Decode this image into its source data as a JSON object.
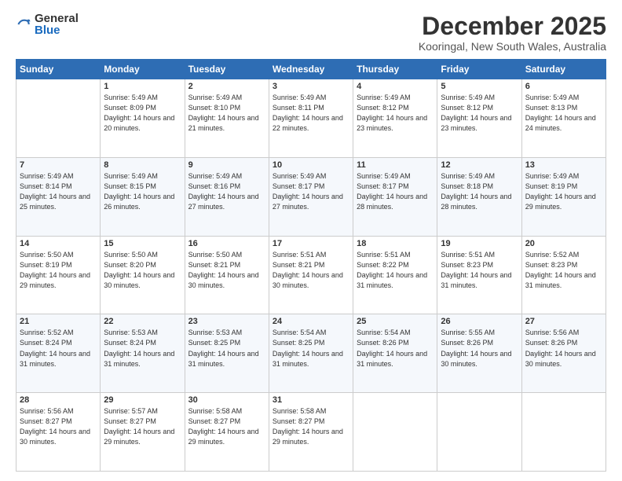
{
  "logo": {
    "general": "General",
    "blue": "Blue"
  },
  "title": "December 2025",
  "subtitle": "Kooringal, New South Wales, Australia",
  "days_header": [
    "Sunday",
    "Monday",
    "Tuesday",
    "Wednesday",
    "Thursday",
    "Friday",
    "Saturday"
  ],
  "weeks": [
    [
      {
        "day": "",
        "sunrise": "",
        "sunset": "",
        "daylight": ""
      },
      {
        "day": "1",
        "sunrise": "Sunrise: 5:49 AM",
        "sunset": "Sunset: 8:09 PM",
        "daylight": "Daylight: 14 hours and 20 minutes."
      },
      {
        "day": "2",
        "sunrise": "Sunrise: 5:49 AM",
        "sunset": "Sunset: 8:10 PM",
        "daylight": "Daylight: 14 hours and 21 minutes."
      },
      {
        "day": "3",
        "sunrise": "Sunrise: 5:49 AM",
        "sunset": "Sunset: 8:11 PM",
        "daylight": "Daylight: 14 hours and 22 minutes."
      },
      {
        "day": "4",
        "sunrise": "Sunrise: 5:49 AM",
        "sunset": "Sunset: 8:12 PM",
        "daylight": "Daylight: 14 hours and 23 minutes."
      },
      {
        "day": "5",
        "sunrise": "Sunrise: 5:49 AM",
        "sunset": "Sunset: 8:12 PM",
        "daylight": "Daylight: 14 hours and 23 minutes."
      },
      {
        "day": "6",
        "sunrise": "Sunrise: 5:49 AM",
        "sunset": "Sunset: 8:13 PM",
        "daylight": "Daylight: 14 hours and 24 minutes."
      }
    ],
    [
      {
        "day": "7",
        "sunrise": "Sunrise: 5:49 AM",
        "sunset": "Sunset: 8:14 PM",
        "daylight": "Daylight: 14 hours and 25 minutes."
      },
      {
        "day": "8",
        "sunrise": "Sunrise: 5:49 AM",
        "sunset": "Sunset: 8:15 PM",
        "daylight": "Daylight: 14 hours and 26 minutes."
      },
      {
        "day": "9",
        "sunrise": "Sunrise: 5:49 AM",
        "sunset": "Sunset: 8:16 PM",
        "daylight": "Daylight: 14 hours and 27 minutes."
      },
      {
        "day": "10",
        "sunrise": "Sunrise: 5:49 AM",
        "sunset": "Sunset: 8:17 PM",
        "daylight": "Daylight: 14 hours and 27 minutes."
      },
      {
        "day": "11",
        "sunrise": "Sunrise: 5:49 AM",
        "sunset": "Sunset: 8:17 PM",
        "daylight": "Daylight: 14 hours and 28 minutes."
      },
      {
        "day": "12",
        "sunrise": "Sunrise: 5:49 AM",
        "sunset": "Sunset: 8:18 PM",
        "daylight": "Daylight: 14 hours and 28 minutes."
      },
      {
        "day": "13",
        "sunrise": "Sunrise: 5:49 AM",
        "sunset": "Sunset: 8:19 PM",
        "daylight": "Daylight: 14 hours and 29 minutes."
      }
    ],
    [
      {
        "day": "14",
        "sunrise": "Sunrise: 5:50 AM",
        "sunset": "Sunset: 8:19 PM",
        "daylight": "Daylight: 14 hours and 29 minutes."
      },
      {
        "day": "15",
        "sunrise": "Sunrise: 5:50 AM",
        "sunset": "Sunset: 8:20 PM",
        "daylight": "Daylight: 14 hours and 30 minutes."
      },
      {
        "day": "16",
        "sunrise": "Sunrise: 5:50 AM",
        "sunset": "Sunset: 8:21 PM",
        "daylight": "Daylight: 14 hours and 30 minutes."
      },
      {
        "day": "17",
        "sunrise": "Sunrise: 5:51 AM",
        "sunset": "Sunset: 8:21 PM",
        "daylight": "Daylight: 14 hours and 30 minutes."
      },
      {
        "day": "18",
        "sunrise": "Sunrise: 5:51 AM",
        "sunset": "Sunset: 8:22 PM",
        "daylight": "Daylight: 14 hours and 31 minutes."
      },
      {
        "day": "19",
        "sunrise": "Sunrise: 5:51 AM",
        "sunset": "Sunset: 8:23 PM",
        "daylight": "Daylight: 14 hours and 31 minutes."
      },
      {
        "day": "20",
        "sunrise": "Sunrise: 5:52 AM",
        "sunset": "Sunset: 8:23 PM",
        "daylight": "Daylight: 14 hours and 31 minutes."
      }
    ],
    [
      {
        "day": "21",
        "sunrise": "Sunrise: 5:52 AM",
        "sunset": "Sunset: 8:24 PM",
        "daylight": "Daylight: 14 hours and 31 minutes."
      },
      {
        "day": "22",
        "sunrise": "Sunrise: 5:53 AM",
        "sunset": "Sunset: 8:24 PM",
        "daylight": "Daylight: 14 hours and 31 minutes."
      },
      {
        "day": "23",
        "sunrise": "Sunrise: 5:53 AM",
        "sunset": "Sunset: 8:25 PM",
        "daylight": "Daylight: 14 hours and 31 minutes."
      },
      {
        "day": "24",
        "sunrise": "Sunrise: 5:54 AM",
        "sunset": "Sunset: 8:25 PM",
        "daylight": "Daylight: 14 hours and 31 minutes."
      },
      {
        "day": "25",
        "sunrise": "Sunrise: 5:54 AM",
        "sunset": "Sunset: 8:26 PM",
        "daylight": "Daylight: 14 hours and 31 minutes."
      },
      {
        "day": "26",
        "sunrise": "Sunrise: 5:55 AM",
        "sunset": "Sunset: 8:26 PM",
        "daylight": "Daylight: 14 hours and 30 minutes."
      },
      {
        "day": "27",
        "sunrise": "Sunrise: 5:56 AM",
        "sunset": "Sunset: 8:26 PM",
        "daylight": "Daylight: 14 hours and 30 minutes."
      }
    ],
    [
      {
        "day": "28",
        "sunrise": "Sunrise: 5:56 AM",
        "sunset": "Sunset: 8:27 PM",
        "daylight": "Daylight: 14 hours and 30 minutes."
      },
      {
        "day": "29",
        "sunrise": "Sunrise: 5:57 AM",
        "sunset": "Sunset: 8:27 PM",
        "daylight": "Daylight: 14 hours and 29 minutes."
      },
      {
        "day": "30",
        "sunrise": "Sunrise: 5:58 AM",
        "sunset": "Sunset: 8:27 PM",
        "daylight": "Daylight: 14 hours and 29 minutes."
      },
      {
        "day": "31",
        "sunrise": "Sunrise: 5:58 AM",
        "sunset": "Sunset: 8:27 PM",
        "daylight": "Daylight: 14 hours and 29 minutes."
      },
      {
        "day": "",
        "sunrise": "",
        "sunset": "",
        "daylight": ""
      },
      {
        "day": "",
        "sunrise": "",
        "sunset": "",
        "daylight": ""
      },
      {
        "day": "",
        "sunrise": "",
        "sunset": "",
        "daylight": ""
      }
    ]
  ]
}
